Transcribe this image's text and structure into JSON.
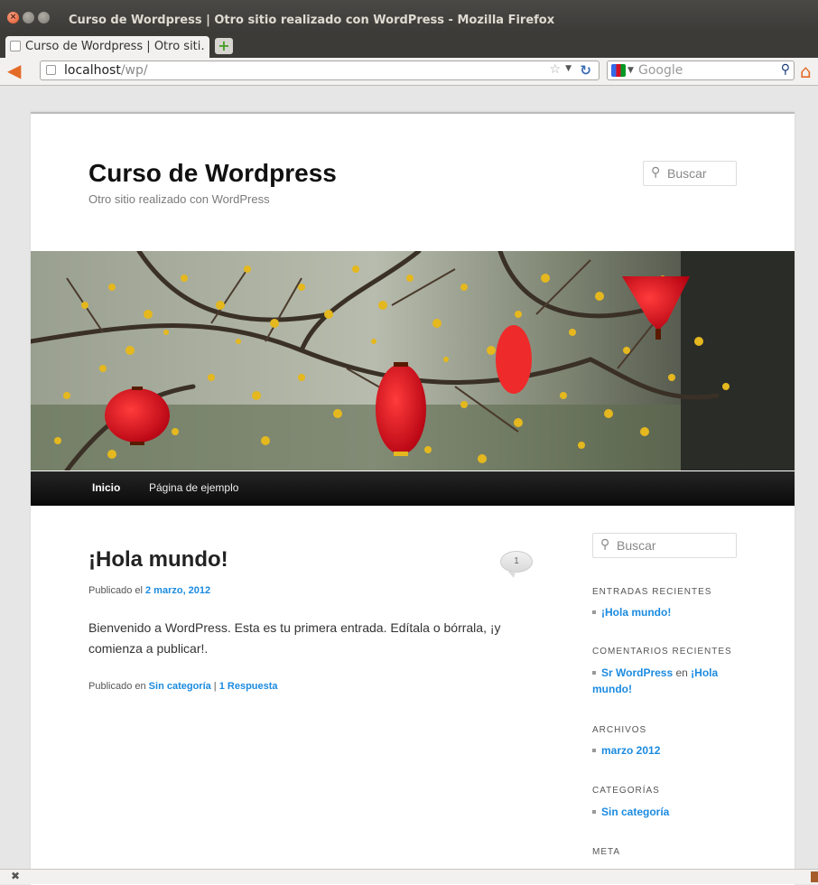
{
  "window": {
    "title": "Curso de Wordpress | Otro sitio realizado con WordPress - Mozilla Firefox"
  },
  "tabs": [
    {
      "label": "Curso de Wordpress | Otro siti…"
    }
  ],
  "toolbar": {
    "url_host": "localhost",
    "url_path": "/wp/",
    "search_placeholder": "Google"
  },
  "site": {
    "title": "Curso de Wordpress",
    "description": "Otro sitio realizado con WordPress",
    "search_placeholder": "Buscar"
  },
  "menu": {
    "items": [
      {
        "label": "Inicio",
        "active": true
      },
      {
        "label": "Página de ejemplo",
        "active": false
      }
    ]
  },
  "post": {
    "title": "¡Hola mundo!",
    "comment_count": "1",
    "meta_prefix": "Publicado el ",
    "date": "2 marzo, 2012",
    "content": "Bienvenido a WordPress. Esta es tu primera entrada. Edítala o bórrala, ¡y comienza a publicar!.",
    "footer_prefix": "Publicado en ",
    "category": "Sin categoría",
    "separator": " | ",
    "replies": "1 Respuesta"
  },
  "sidebar": {
    "search_placeholder": "Buscar",
    "recent_posts": {
      "title": "ENTRADAS RECIENTES",
      "items": [
        "¡Hola mundo!"
      ]
    },
    "recent_comments": {
      "title": "COMENTARIOS RECIENTES",
      "author": "Sr WordPress",
      "connector": " en ",
      "post": "¡Hola mundo!"
    },
    "archives": {
      "title": "ARCHIVOS",
      "items": [
        "marzo 2012"
      ]
    },
    "categories": {
      "title": "CATEGORÍAS",
      "items": [
        "Sin categoría"
      ]
    },
    "meta": {
      "title": "META"
    }
  },
  "colors": {
    "link": "#1b8be0",
    "menu_bg": "#111111",
    "firefox_orange": "#e46a27"
  }
}
